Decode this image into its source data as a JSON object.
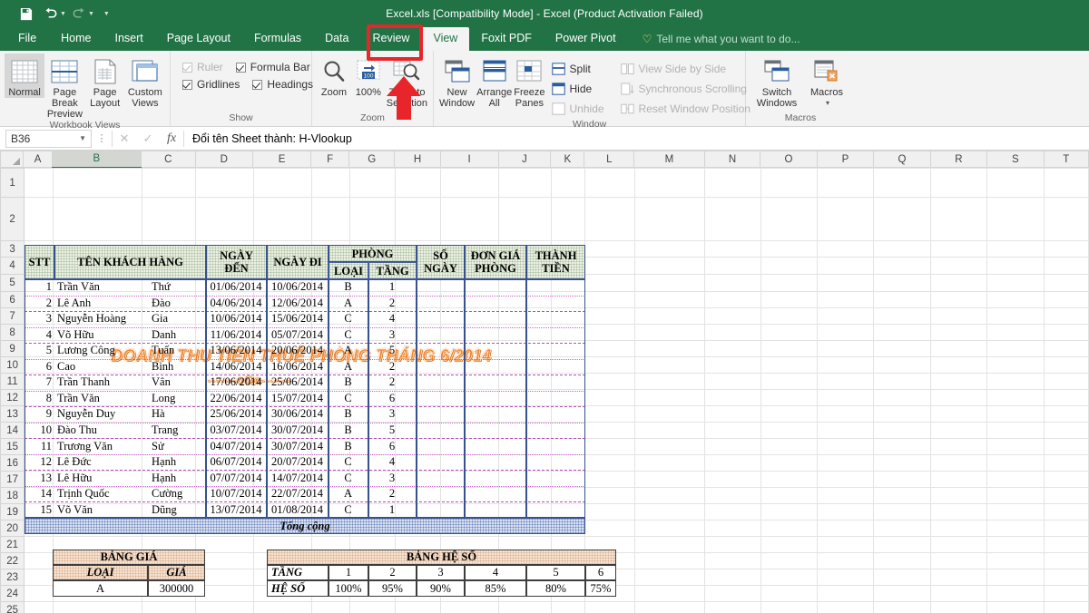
{
  "window": {
    "title": "Excel.xls  [Compatibility Mode] - Excel (Product Activation Failed)",
    "accent_green": "#217346",
    "quick_access": [
      {
        "name": "save",
        "icon": "save-icon"
      },
      {
        "name": "undo",
        "icon": "undo-icon"
      },
      {
        "name": "redo",
        "icon": "redo-icon"
      },
      {
        "name": "customize",
        "icon": "chevron-down-icon"
      }
    ]
  },
  "tabs": [
    {
      "label": "File",
      "active": false
    },
    {
      "label": "Home",
      "active": false
    },
    {
      "label": "Insert",
      "active": false
    },
    {
      "label": "Page Layout",
      "active": false
    },
    {
      "label": "Formulas",
      "active": false
    },
    {
      "label": "Data",
      "active": false
    },
    {
      "label": "Review",
      "active": false
    },
    {
      "label": "View",
      "active": true
    },
    {
      "label": "Foxit PDF",
      "active": false
    },
    {
      "label": "Power Pivot",
      "active": false
    }
  ],
  "tellme": {
    "placeholder": "Tell me what you want to do...",
    "icon": "lightbulb-icon"
  },
  "ribbon": {
    "groups": [
      {
        "label": "Workbook Views",
        "buttons": [
          {
            "label": "Normal",
            "selected": true,
            "icon": "normal-view-icon"
          },
          {
            "label": "Page Break Preview",
            "selected": false,
            "icon": "page-break-preview-icon"
          },
          {
            "label": "Page Layout",
            "selected": false,
            "icon": "page-layout-icon"
          },
          {
            "label": "Custom Views",
            "selected": false,
            "icon": "custom-views-icon"
          }
        ]
      },
      {
        "label": "Show",
        "checkboxes": [
          {
            "label": "Ruler",
            "checked": true,
            "disabled": true
          },
          {
            "label": "Formula Bar",
            "checked": true,
            "disabled": false
          },
          {
            "label": "Gridlines",
            "checked": true,
            "disabled": false
          },
          {
            "label": "Headings",
            "checked": true,
            "disabled": false
          }
        ]
      },
      {
        "label": "Zoom",
        "buttons": [
          {
            "label": "Zoom",
            "icon": "magnifier-icon"
          },
          {
            "label": "100%",
            "icon": "zoom-100-icon"
          },
          {
            "label": "Zoom to Selection",
            "icon": "zoom-to-selection-icon"
          }
        ]
      },
      {
        "label": "Window",
        "buttons": [
          {
            "label": "New Window",
            "icon": "new-window-icon"
          },
          {
            "label": "Arrange All",
            "icon": "arrange-all-icon"
          },
          {
            "label": "Freeze Panes",
            "icon": "freeze-panes-icon",
            "has_caret": true
          }
        ],
        "small_buttons": [
          {
            "label": "Split",
            "disabled": false,
            "icon": "split-icon"
          },
          {
            "label": "Hide",
            "disabled": false,
            "icon": "hide-icon"
          },
          {
            "label": "Unhide",
            "disabled": true,
            "icon": "unhide-icon"
          },
          {
            "label": "View Side by Side",
            "disabled": true,
            "icon": "view-side-by-side-icon"
          },
          {
            "label": "Synchronous Scrolling",
            "disabled": true,
            "icon": "sync-scrolling-icon"
          },
          {
            "label": "Reset Window Position",
            "disabled": true,
            "icon": "reset-window-position-icon"
          }
        ]
      },
      {
        "label": "Macros",
        "buttons": [
          {
            "label": "Switch Windows",
            "icon": "switch-windows-icon",
            "has_caret": true
          },
          {
            "label": "Macros",
            "icon": "macros-icon",
            "has_caret": true
          }
        ]
      }
    ]
  },
  "formula_bar": {
    "name_box": "B36",
    "cancel_icon": "close-icon",
    "confirm_icon": "check-icon",
    "function_icon": "fx-icon",
    "value": "Đổi tên Sheet thành: H-Vlookup"
  },
  "grid": {
    "columns": [
      "A",
      "B",
      "C",
      "D",
      "E",
      "F",
      "G",
      "H",
      "I",
      "J",
      "K",
      "L",
      "M",
      "N",
      "O",
      "P",
      "Q",
      "R",
      "S",
      "T"
    ],
    "selected_column": "B",
    "rows": [
      1,
      2,
      3,
      4,
      5,
      6,
      7,
      8,
      9,
      10,
      11,
      12,
      13,
      14,
      15,
      16,
      17,
      18,
      19,
      20,
      21,
      22,
      23,
      24,
      25
    ]
  },
  "sheet": {
    "title": "DOANH THU TIỀN THUÊ PHÒNG THÁNG 6/2014",
    "subtitle": "-------oOo-------",
    "title_color": "#F0852C",
    "headers": {
      "stt": "STT",
      "customer": "TÊN  KHÁCH HÀNG",
      "arrive": "NGÀY ĐẾN",
      "leave": "NGÀY ĐI",
      "room": "PHÒNG",
      "room_type": "LOẠI",
      "room_floor": "TẦNG",
      "days": "SỐ NGÀY",
      "unit_price": "ĐƠN GIÁ PHÒNG",
      "amount": "THÀNH TIỀN"
    },
    "rows": [
      {
        "stt": "1",
        "last": "Trần Văn",
        "first": "Thứ",
        "arrive": "01/06/2014",
        "leave": "10/06/2014",
        "type": "B",
        "floor": "1",
        "days": "",
        "price": "",
        "amount": ""
      },
      {
        "stt": "2",
        "last": "Lê Anh",
        "first": "Đào",
        "arrive": "04/06/2014",
        "leave": "12/06/2014",
        "type": "A",
        "floor": "2",
        "days": "",
        "price": "",
        "amount": ""
      },
      {
        "stt": "3",
        "last": "Nguyễn Hoàng",
        "first": "Gia",
        "arrive": "10/06/2014",
        "leave": "15/06/2014",
        "type": "C",
        "floor": "4",
        "days": "",
        "price": "",
        "amount": ""
      },
      {
        "stt": "4",
        "last": "Võ Hữu",
        "first": "Danh",
        "arrive": "11/06/2014",
        "leave": "05/07/2014",
        "type": "C",
        "floor": "3",
        "days": "",
        "price": "",
        "amount": ""
      },
      {
        "stt": "5",
        "last": "Lương Công",
        "first": "Tuấn",
        "arrive": "13/06/2014",
        "leave": "20/06/2014",
        "type": "A",
        "floor": "5",
        "days": "",
        "price": "",
        "amount": ""
      },
      {
        "stt": "6",
        "last": "Cao",
        "first": "Bình",
        "arrive": "14/06/2014",
        "leave": "16/06/2014",
        "type": "A",
        "floor": "2",
        "days": "",
        "price": "",
        "amount": ""
      },
      {
        "stt": "7",
        "last": "Trần Thanh",
        "first": "Vân",
        "arrive": "17/06/2014",
        "leave": "25/06/2014",
        "type": "B",
        "floor": "2",
        "days": "",
        "price": "",
        "amount": ""
      },
      {
        "stt": "8",
        "last": "Trần Văn",
        "first": "Long",
        "arrive": "22/06/2014",
        "leave": "15/07/2014",
        "type": "C",
        "floor": "6",
        "days": "",
        "price": "",
        "amount": ""
      },
      {
        "stt": "9",
        "last": "Nguyễn Duy",
        "first": "Hà",
        "arrive": "25/06/2014",
        "leave": "30/06/2014",
        "type": "B",
        "floor": "3",
        "days": "",
        "price": "",
        "amount": ""
      },
      {
        "stt": "10",
        "last": "Đào Thu",
        "first": "Trang",
        "arrive": "03/07/2014",
        "leave": "30/07/2014",
        "type": "B",
        "floor": "5",
        "days": "",
        "price": "",
        "amount": ""
      },
      {
        "stt": "11",
        "last": "Trương Văn",
        "first": "Sử",
        "arrive": "04/07/2014",
        "leave": "30/07/2014",
        "type": "B",
        "floor": "6",
        "days": "",
        "price": "",
        "amount": ""
      },
      {
        "stt": "12",
        "last": "Lê Đức",
        "first": "Hạnh",
        "arrive": "06/07/2014",
        "leave": "20/07/2014",
        "type": "C",
        "floor": "4",
        "days": "",
        "price": "",
        "amount": ""
      },
      {
        "stt": "13",
        "last": "Lê Hữu",
        "first": "Hạnh",
        "arrive": "07/07/2014",
        "leave": "14/07/2014",
        "type": "C",
        "floor": "3",
        "days": "",
        "price": "",
        "amount": ""
      },
      {
        "stt": "14",
        "last": "Trịnh Quốc",
        "first": "Cường",
        "arrive": "10/07/2014",
        "leave": "22/07/2014",
        "type": "A",
        "floor": "2",
        "days": "",
        "price": "",
        "amount": ""
      },
      {
        "stt": "15",
        "last": "Võ Văn",
        "first": "Dũng",
        "arrive": "13/07/2014",
        "leave": "01/08/2014",
        "type": "C",
        "floor": "1",
        "days": "",
        "price": "",
        "amount": ""
      }
    ],
    "total_label": "Tổng cộng",
    "price_table": {
      "title": "BẢNG GIÁ",
      "col_type": "LOẠI",
      "col_price": "GIÁ",
      "rows": [
        {
          "type": "A",
          "price": "300000"
        }
      ]
    },
    "coef_table": {
      "title": "BẢNG HỆ SỐ",
      "row_floor_label": "TẦNG",
      "row_coef_label": "HỆ SỐ",
      "floors": [
        "1",
        "2",
        "3",
        "4",
        "5",
        "6"
      ],
      "coefficients": [
        "100%",
        "95%",
        "90%",
        "85%",
        "80%",
        "75%"
      ]
    }
  },
  "annotations": {
    "highlight_target": "View",
    "arrow_target": "Zoom to Selection",
    "color": "#e8252a"
  }
}
